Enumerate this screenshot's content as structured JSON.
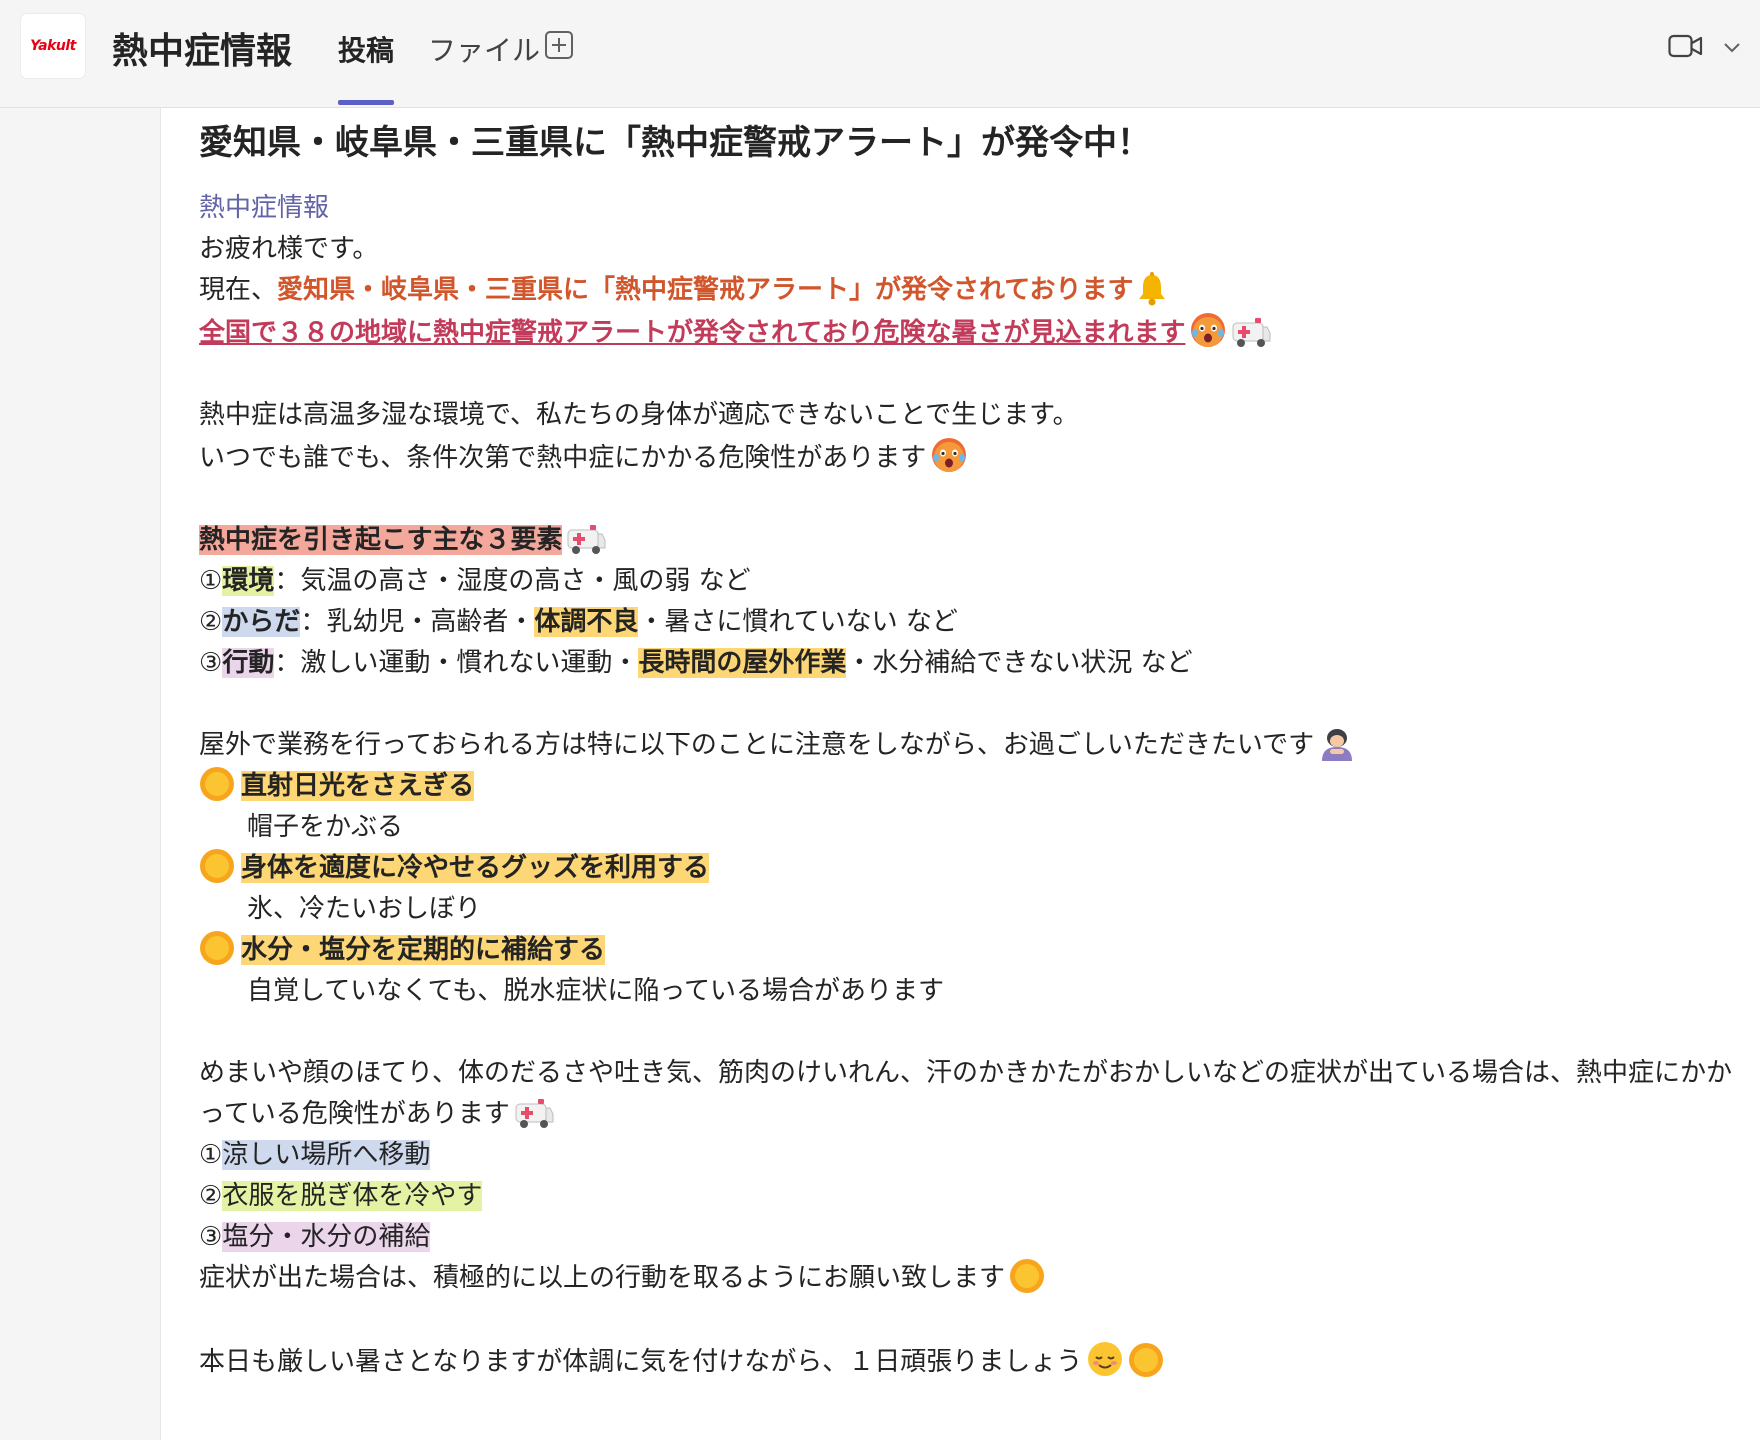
{
  "header": {
    "logo_text": "Yakult",
    "channel_title": "熱中症情報",
    "tabs": [
      {
        "label": "投稿",
        "active": true
      },
      {
        "label": "ファイル",
        "active": false
      }
    ]
  },
  "post": {
    "subject": "愛知県・岐阜県・三重県に「熱中症警戒アラート」が発令中！",
    "mention": "熱中症情報",
    "greeting": "お疲れ様です。",
    "alert_prefix": "現在、",
    "alert_text": "愛知県・岐阜県・三重県に「熱中症警戒アラート」が発令されております",
    "national_text": "全国で３８の地域に熱中症警戒アラートが発令されており危険な暑さが見込まれます",
    "intro_line1": "熱中症は高温多湿な環境で、私たちの身体が適応できないことで生じます。",
    "intro_line2": "いつでも誰でも、条件次第で熱中症にかかる危険性があります",
    "factors_title": "熱中症を引き起こす主な３要素",
    "factor1_num": "①",
    "factor1_label": "環境",
    "factor1_text": "：気温の高さ・湿度の高さ・風の弱 など",
    "factor2_num": "②",
    "factor2_label": "からだ",
    "factor2_text_a": "：乳幼児・高齢者・",
    "factor2_highlight": "体調不良",
    "factor2_text_b": "・暑さに慣れていない など",
    "factor3_num": "③",
    "factor3_label": "行動",
    "factor3_text_a": "：激しい運動・慣れない運動・",
    "factor3_highlight": "長時間の屋外作業",
    "factor3_text_b": "・水分補給できない状況 など",
    "outdoor_intro": "屋外で業務を行っておられる方は特に以下のことに注意をしながら、お過ごしいただきたいです",
    "tips": [
      {
        "title": "直射日光をさえぎる",
        "detail": "帽子をかぶる"
      },
      {
        "title": "身体を適度に冷やせるグッズを利用する",
        "detail": "氷、冷たいおしぼり"
      },
      {
        "title": "水分・塩分を定期的に補給する",
        "detail": "自覚していなくても、脱水症状に陥っている場合があります"
      }
    ],
    "symptoms_text": "めまいや顔のほてり、体のだるさや吐き気、筋肉のけいれん、汗のかきかたがおかしいなどの症状が出ている場合は、熱中症にかかっている危険性があります",
    "actions": [
      {
        "num": "①",
        "text": "涼しい場所へ移動"
      },
      {
        "num": "②",
        "text": "衣服を脱ぎ体を冷やす"
      },
      {
        "num": "③",
        "text": "塩分・水分の補給"
      }
    ],
    "action_request": "症状が出た場合は、積極的に以上の行動を取るようにお願い致します",
    "closing": "本日も厳しい暑さとなりますが体調に気を付けながら、１日頑張りましょう"
  },
  "colors": {
    "accent": "#5b5fc7",
    "mention": "#6264a7",
    "alert_orange": "#d1562c",
    "alert_red": "#c23b5a",
    "highlight_red": "#f3a89b",
    "highlight_green": "#e4f3a3",
    "highlight_blue": "#cfd9ee",
    "highlight_purple": "#ead5ea",
    "highlight_yellow": "#fdd675"
  },
  "icons": [
    "video-call-icon",
    "chevron-down-icon",
    "add-tab-icon",
    "bell-emoji",
    "hot-face-emoji",
    "ambulance-emoji",
    "sun-emoji",
    "bowing-person-emoji",
    "relieved-face-emoji"
  ]
}
